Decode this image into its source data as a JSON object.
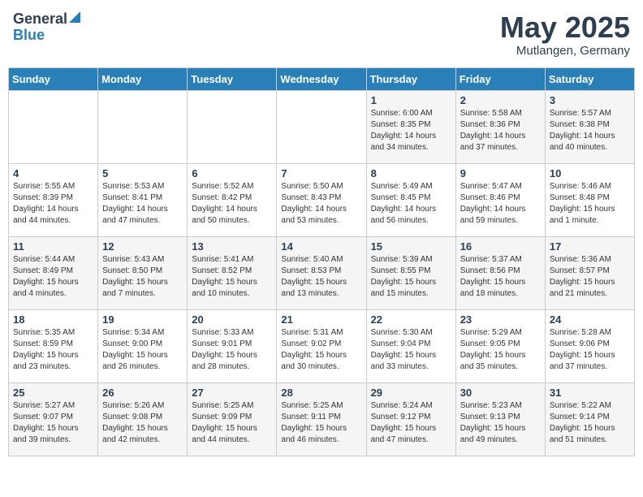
{
  "header": {
    "logo_general": "General",
    "logo_blue": "Blue",
    "month": "May 2025",
    "location": "Mutlangen, Germany"
  },
  "days_of_week": [
    "Sunday",
    "Monday",
    "Tuesday",
    "Wednesday",
    "Thursday",
    "Friday",
    "Saturday"
  ],
  "weeks": [
    [
      {
        "day": "",
        "content": ""
      },
      {
        "day": "",
        "content": ""
      },
      {
        "day": "",
        "content": ""
      },
      {
        "day": "",
        "content": ""
      },
      {
        "day": "1",
        "content": "Sunrise: 6:00 AM\nSunset: 8:35 PM\nDaylight: 14 hours\nand 34 minutes."
      },
      {
        "day": "2",
        "content": "Sunrise: 5:58 AM\nSunset: 8:36 PM\nDaylight: 14 hours\nand 37 minutes."
      },
      {
        "day": "3",
        "content": "Sunrise: 5:57 AM\nSunset: 8:38 PM\nDaylight: 14 hours\nand 40 minutes."
      }
    ],
    [
      {
        "day": "4",
        "content": "Sunrise: 5:55 AM\nSunset: 8:39 PM\nDaylight: 14 hours\nand 44 minutes."
      },
      {
        "day": "5",
        "content": "Sunrise: 5:53 AM\nSunset: 8:41 PM\nDaylight: 14 hours\nand 47 minutes."
      },
      {
        "day": "6",
        "content": "Sunrise: 5:52 AM\nSunset: 8:42 PM\nDaylight: 14 hours\nand 50 minutes."
      },
      {
        "day": "7",
        "content": "Sunrise: 5:50 AM\nSunset: 8:43 PM\nDaylight: 14 hours\nand 53 minutes."
      },
      {
        "day": "8",
        "content": "Sunrise: 5:49 AM\nSunset: 8:45 PM\nDaylight: 14 hours\nand 56 minutes."
      },
      {
        "day": "9",
        "content": "Sunrise: 5:47 AM\nSunset: 8:46 PM\nDaylight: 14 hours\nand 59 minutes."
      },
      {
        "day": "10",
        "content": "Sunrise: 5:46 AM\nSunset: 8:48 PM\nDaylight: 15 hours\nand 1 minute."
      }
    ],
    [
      {
        "day": "11",
        "content": "Sunrise: 5:44 AM\nSunset: 8:49 PM\nDaylight: 15 hours\nand 4 minutes."
      },
      {
        "day": "12",
        "content": "Sunrise: 5:43 AM\nSunset: 8:50 PM\nDaylight: 15 hours\nand 7 minutes."
      },
      {
        "day": "13",
        "content": "Sunrise: 5:41 AM\nSunset: 8:52 PM\nDaylight: 15 hours\nand 10 minutes."
      },
      {
        "day": "14",
        "content": "Sunrise: 5:40 AM\nSunset: 8:53 PM\nDaylight: 15 hours\nand 13 minutes."
      },
      {
        "day": "15",
        "content": "Sunrise: 5:39 AM\nSunset: 8:55 PM\nDaylight: 15 hours\nand 15 minutes."
      },
      {
        "day": "16",
        "content": "Sunrise: 5:37 AM\nSunset: 8:56 PM\nDaylight: 15 hours\nand 18 minutes."
      },
      {
        "day": "17",
        "content": "Sunrise: 5:36 AM\nSunset: 8:57 PM\nDaylight: 15 hours\nand 21 minutes."
      }
    ],
    [
      {
        "day": "18",
        "content": "Sunrise: 5:35 AM\nSunset: 8:59 PM\nDaylight: 15 hours\nand 23 minutes."
      },
      {
        "day": "19",
        "content": "Sunrise: 5:34 AM\nSunset: 9:00 PM\nDaylight: 15 hours\nand 26 minutes."
      },
      {
        "day": "20",
        "content": "Sunrise: 5:33 AM\nSunset: 9:01 PM\nDaylight: 15 hours\nand 28 minutes."
      },
      {
        "day": "21",
        "content": "Sunrise: 5:31 AM\nSunset: 9:02 PM\nDaylight: 15 hours\nand 30 minutes."
      },
      {
        "day": "22",
        "content": "Sunrise: 5:30 AM\nSunset: 9:04 PM\nDaylight: 15 hours\nand 33 minutes."
      },
      {
        "day": "23",
        "content": "Sunrise: 5:29 AM\nSunset: 9:05 PM\nDaylight: 15 hours\nand 35 minutes."
      },
      {
        "day": "24",
        "content": "Sunrise: 5:28 AM\nSunset: 9:06 PM\nDaylight: 15 hours\nand 37 minutes."
      }
    ],
    [
      {
        "day": "25",
        "content": "Sunrise: 5:27 AM\nSunset: 9:07 PM\nDaylight: 15 hours\nand 39 minutes."
      },
      {
        "day": "26",
        "content": "Sunrise: 5:26 AM\nSunset: 9:08 PM\nDaylight: 15 hours\nand 42 minutes."
      },
      {
        "day": "27",
        "content": "Sunrise: 5:25 AM\nSunset: 9:09 PM\nDaylight: 15 hours\nand 44 minutes."
      },
      {
        "day": "28",
        "content": "Sunrise: 5:25 AM\nSunset: 9:11 PM\nDaylight: 15 hours\nand 46 minutes."
      },
      {
        "day": "29",
        "content": "Sunrise: 5:24 AM\nSunset: 9:12 PM\nDaylight: 15 hours\nand 47 minutes."
      },
      {
        "day": "30",
        "content": "Sunrise: 5:23 AM\nSunset: 9:13 PM\nDaylight: 15 hours\nand 49 minutes."
      },
      {
        "day": "31",
        "content": "Sunrise: 5:22 AM\nSunset: 9:14 PM\nDaylight: 15 hours\nand 51 minutes."
      }
    ]
  ]
}
